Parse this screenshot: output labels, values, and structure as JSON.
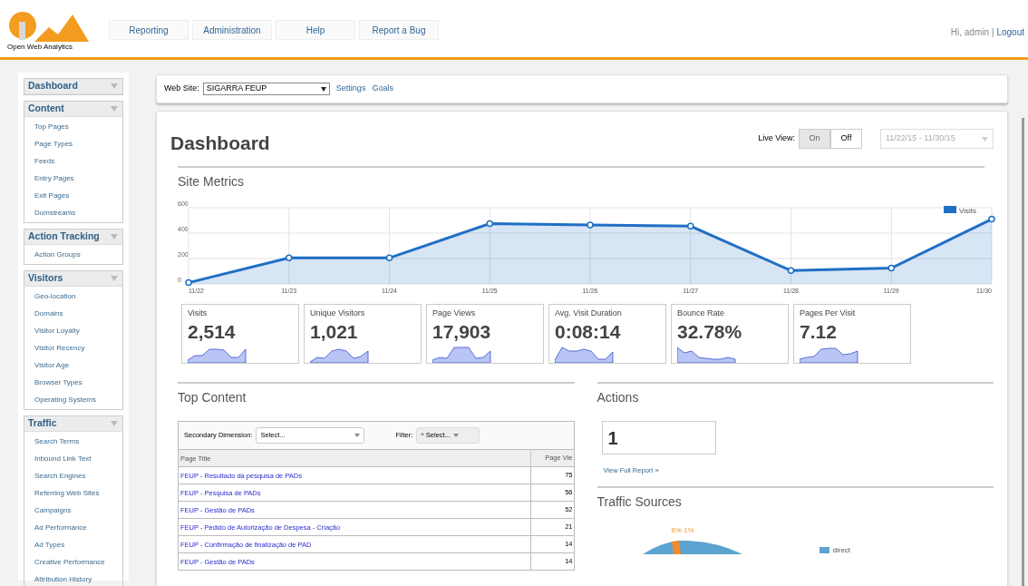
{
  "header": {
    "logo_text": "Open Web Analytics",
    "nav": [
      {
        "label": "Reporting"
      },
      {
        "label": "Administration"
      },
      {
        "label": "Help"
      },
      {
        "label": "Report a Bug"
      }
    ],
    "greeting": "Hi, admin |",
    "logout": "Logout"
  },
  "sidebar": [
    {
      "title": "Dashboard"
    },
    {
      "title": "Content",
      "items": [
        "Top Pages",
        "Page Types",
        "Feeds",
        "Entry Pages",
        "Exit Pages",
        "Domstreams"
      ]
    },
    {
      "title": "Action Tracking",
      "items": [
        "Action Groups"
      ]
    },
    {
      "title": "Visitors",
      "items": [
        "Geo-location",
        "Domains",
        "Visitor Loyalty",
        "Visitor Recency",
        "Visitor Age",
        "Browser Types",
        "Operating Systems"
      ]
    },
    {
      "title": "Traffic",
      "items": [
        "Search Terms",
        "Inbound Link Text",
        "Search Engines",
        "Referring Web Sites",
        "Campaigns",
        "Ad Performance",
        "Ad Types",
        "Creative Performance",
        "Attribution History"
      ]
    }
  ],
  "site_bar": {
    "label": "Web Site:",
    "site": "SIGARRA FEUP",
    "links": [
      "Settings",
      "Goals"
    ]
  },
  "dashboard": {
    "title": "Dashboard",
    "live_view": {
      "label": "Live View:",
      "options": [
        {
          "label": "On",
          "selected": false
        },
        {
          "label": "Off",
          "selected": true
        }
      ]
    },
    "date_range": "11/22/15 - 11/30/15",
    "site_metrics": {
      "title": "Site Metrics",
      "chart_data": {
        "type": "area",
        "grid": true,
        "categories": [
          "11/22",
          "11/23",
          "11/24",
          "11/25",
          "11/26",
          "11/27",
          "11/28",
          "11/29",
          "11/30"
        ],
        "ylim": [
          0,
          600
        ],
        "yticks": [
          0,
          200,
          400,
          600
        ],
        "series": [
          {
            "name": "Visits",
            "color": "#1f6fc5",
            "values": [
              10,
              205,
              205,
              475,
              465,
              455,
              105,
              125,
              510
            ]
          }
        ]
      }
    },
    "metrics": [
      {
        "label": "Visits",
        "value": "2,514"
      },
      {
        "label": "Unique Visitors",
        "value": "1,021"
      },
      {
        "label": "Page Views",
        "value": "17,903"
      },
      {
        "label": "Avg. Visit Duration",
        "value": "0:08:14"
      },
      {
        "label": "Bounce Rate",
        "value": "32.78%"
      },
      {
        "label": "Pages Per Visit",
        "value": "7.12"
      }
    ]
  },
  "top_content": {
    "title": "Top Content",
    "secondary_label": "Secondary Dimension:",
    "secondary_value": "Select...",
    "filter_label": "Filter:",
    "filter_value": "^ Select...",
    "columns": [
      "Page Title",
      "Page Vie"
    ],
    "rows": [
      [
        "FEUP - Resultado da pesquisa de PADs",
        "75"
      ],
      [
        "FEUP - Pesquisa de PADs",
        "56"
      ],
      [
        "FEUP - Gestão de PADs",
        "52"
      ],
      [
        "FEUP - Pedido de Autorização de Despesa - Criação",
        "21"
      ],
      [
        "FEUP - Confirmação de finalização de PAD",
        "14"
      ],
      [
        "FEUP - Gestão de PADs",
        "14"
      ]
    ]
  },
  "actions": {
    "title": "Actions",
    "count": "1",
    "link": "View Full Report »"
  },
  "traffic_sources": {
    "title": "Traffic Sources",
    "labels": [
      "6%",
      "1%"
    ],
    "legend": [
      {
        "label": "direct",
        "color": "#5ba3d0"
      }
    ]
  }
}
